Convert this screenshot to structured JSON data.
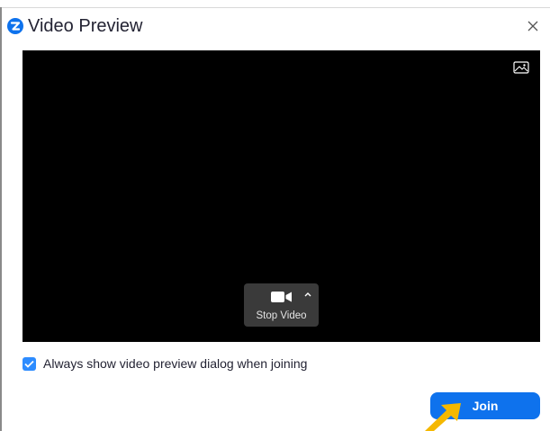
{
  "window": {
    "title": "Video Preview",
    "close_glyph": "×",
    "logo_icon": "zoom-logo-icon",
    "close_icon": "close-icon"
  },
  "preview": {
    "background_color": "#000000",
    "background_icon": "picture-icon",
    "video_control": {
      "label": "Stop Video",
      "icon": "video-camera-icon",
      "menu_icon": "caret-up-icon"
    }
  },
  "options": {
    "always_show_preview": {
      "label": "Always show video preview dialog when joining",
      "checked": true
    }
  },
  "footer": {
    "join_label": "Join"
  },
  "colors": {
    "accent": "#0e72ed",
    "checkbox": "#2d8cff",
    "cursor": "#f5b800"
  }
}
